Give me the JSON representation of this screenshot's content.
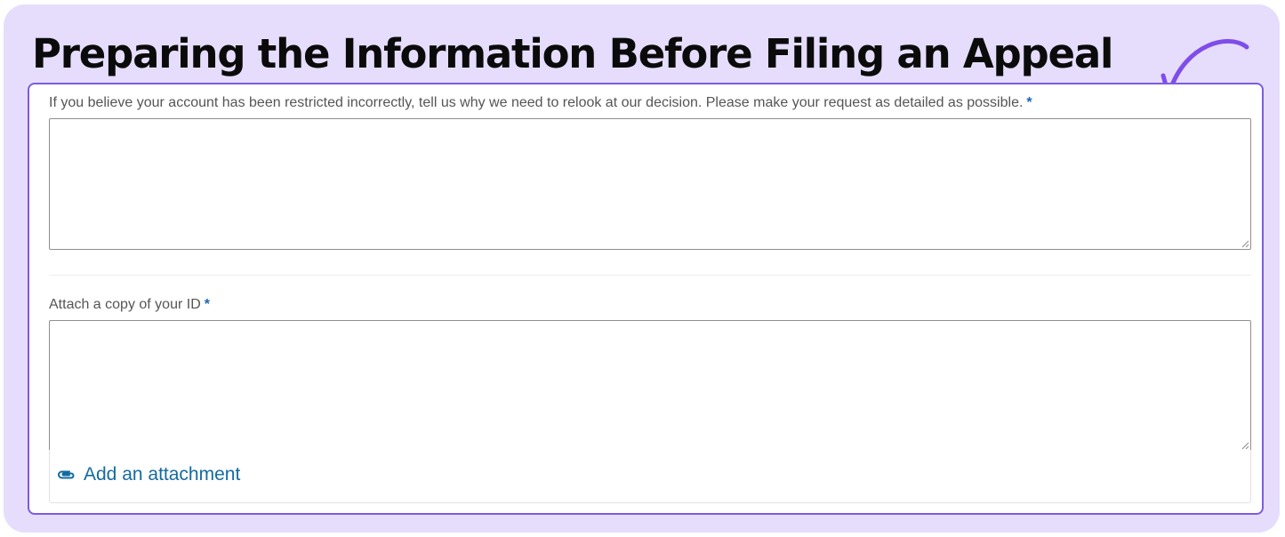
{
  "header": {
    "title": "Preparing the Information Before Filing an Appeal"
  },
  "form": {
    "reason_field": {
      "label": "If you believe your account has been restricted incorrectly, tell us why we need to relook at our decision. Please make your request as detailed as possible.",
      "required_marker": "*",
      "value": ""
    },
    "id_field": {
      "label": "Attach a copy of your ID",
      "required_marker": "*",
      "value": ""
    },
    "attachment": {
      "label": "Add an attachment",
      "icon": "paperclip-icon"
    }
  },
  "colors": {
    "card_background": "#e6ddfd",
    "panel_border": "#7d5ae6",
    "arrow": "#7f4dea",
    "link": "#136b9f",
    "required": "#1c63b8"
  },
  "annotation": {
    "icon": "curved-arrow-icon"
  }
}
